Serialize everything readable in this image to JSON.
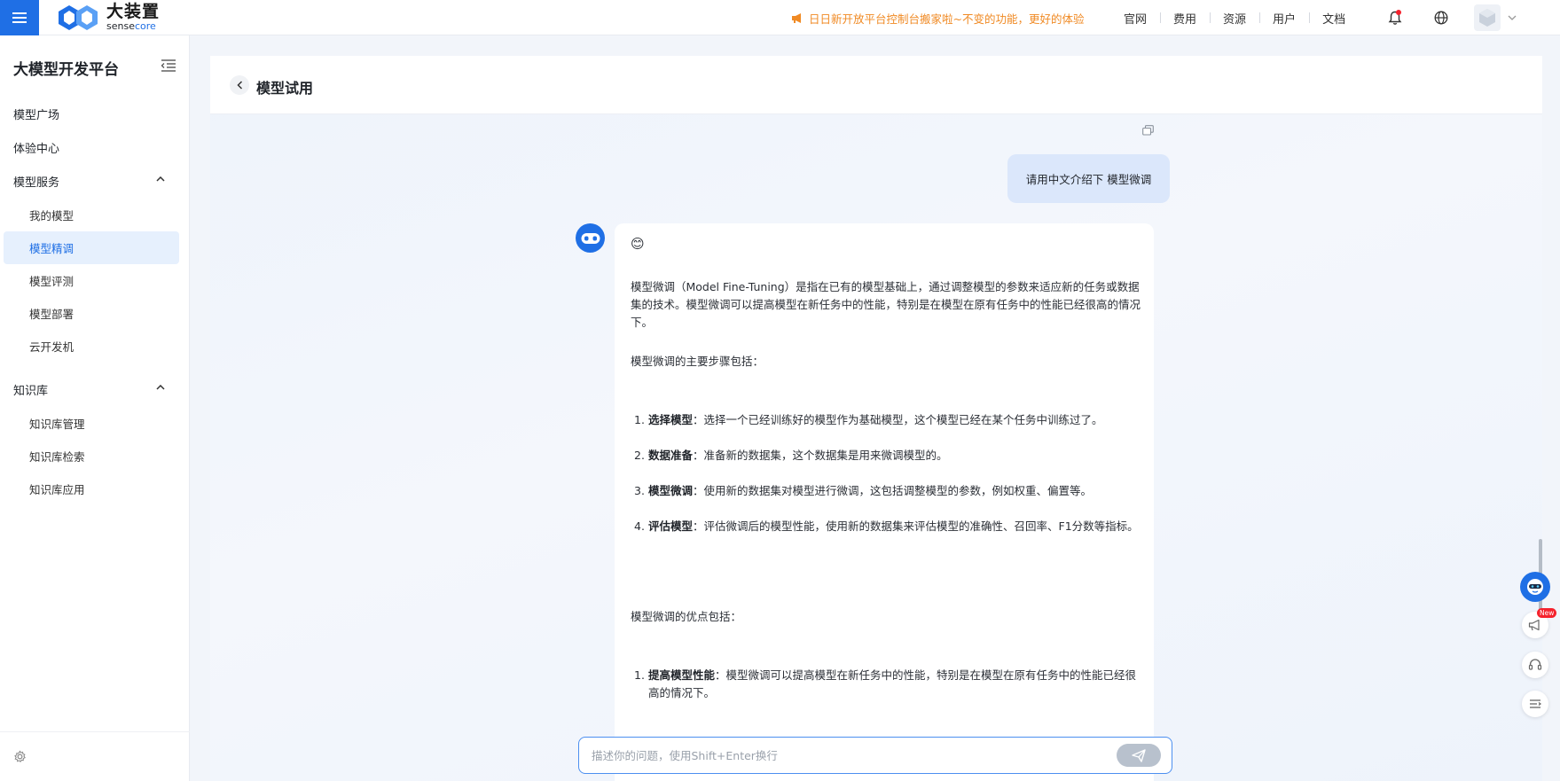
{
  "topbar": {
    "logo_cn": "大装置",
    "logo_en_part1": "sense",
    "logo_en_part2": "core",
    "notice": "日日新开放平台控制台搬家啦~不变的功能，更好的体验",
    "nav": [
      "官网",
      "费用",
      "资源",
      "用户",
      "文档"
    ]
  },
  "sidebar": {
    "title": "大模型开发平台",
    "items": [
      {
        "label": "模型广场"
      },
      {
        "label": "体验中心"
      },
      {
        "label": "模型服务"
      },
      {
        "label": "我的模型"
      },
      {
        "label": "模型精调"
      },
      {
        "label": "模型评测"
      },
      {
        "label": "模型部署"
      },
      {
        "label": "云开发机"
      },
      {
        "label": "知识库"
      },
      {
        "label": "知识库管理"
      },
      {
        "label": "知识库检索"
      },
      {
        "label": "知识库应用"
      }
    ],
    "active": "模型精调"
  },
  "page": {
    "title": "模型试用"
  },
  "chat": {
    "user_message": "请用中文介绍下 模型微调",
    "bot_emoji": "😊",
    "intro": "模型微调（Model Fine-Tuning）是指在已有的模型基础上，通过调整模型的参数来适应新的任务或数据集的技术。模型微调可以提高模型在新任务中的性能，特别是在模型在原有任务中的性能已经很高的情况下。",
    "steps_heading": "模型微调的主要步骤包括：",
    "steps": [
      {
        "num": "1.",
        "term": "选择模型",
        "text": "：选择一个已经训练好的模型作为基础模型，这个模型已经在某个任务中训练过了。"
      },
      {
        "num": "2.",
        "term": "数据准备",
        "text": "：准备新的数据集，这个数据集是用来微调模型的。"
      },
      {
        "num": "3.",
        "term": "模型微调",
        "text": "：使用新的数据集对模型进行微调，这包括调整模型的参数，例如权重、偏置等。"
      },
      {
        "num": "4.",
        "term": "评估模型",
        "text": "：评估微调后的模型性能，使用新的数据集来评估模型的准确性、召回率、F1分数等指标。"
      }
    ],
    "benefits_heading": "模型微调的优点包括：",
    "benefits": [
      {
        "num": "1.",
        "term": "提高模型性能",
        "text": "：模型微调可以提高模型在新任务中的性能，特别是在模型在原有任务中的性能已经很高的情况下。"
      }
    ],
    "input_placeholder": "描述你的问题，使用Shift+Enter换行"
  },
  "float_tools": {
    "new_badge": "New"
  },
  "colors": {
    "primary": "#1f6fe5",
    "notice": "#f08a24",
    "active_bg": "#e6f0fd",
    "user_bubble": "#dbe7fb"
  }
}
